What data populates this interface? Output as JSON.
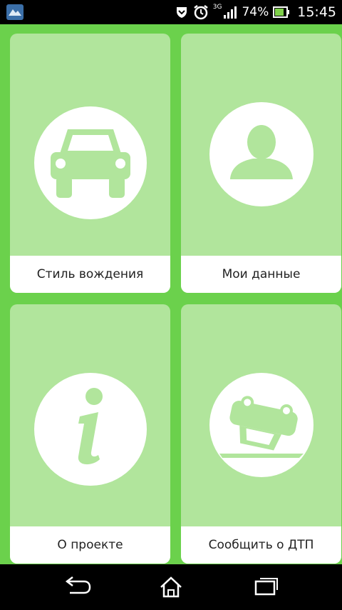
{
  "status_bar": {
    "network": "3G",
    "battery_percent": "74%",
    "time": "15:45",
    "icons": [
      "app-notification-icon",
      "shield-icon",
      "alarm-clock-icon",
      "signal-icon",
      "battery-icon"
    ]
  },
  "tiles": [
    {
      "label": "Стиль вождения",
      "icon": "car-icon"
    },
    {
      "label": "Мои данные",
      "icon": "user-icon"
    },
    {
      "label": "О проекте",
      "icon": "info-icon"
    },
    {
      "label": "Сообщить о ДТП",
      "icon": "car-accident-icon"
    }
  ],
  "nav_bar": {
    "buttons": [
      "back-icon",
      "home-icon",
      "recent-apps-icon"
    ]
  },
  "colors": {
    "background": "#6bd14c",
    "tile": "#b1e59c",
    "label_bg": "#ffffff",
    "icon_fill": "#b1e59c"
  }
}
